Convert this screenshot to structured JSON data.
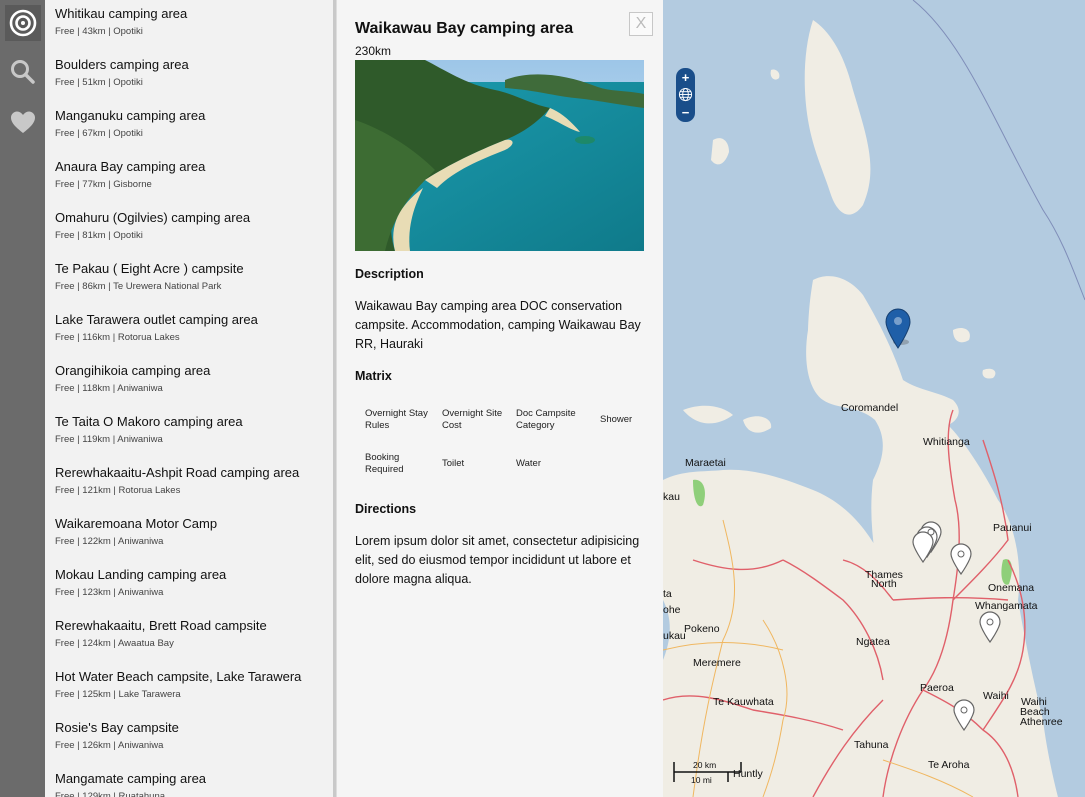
{
  "rail": {
    "icons": [
      "target-icon",
      "search-icon",
      "heart-icon"
    ]
  },
  "list": {
    "items": [
      {
        "name": "Whitikau camping area",
        "meta": "Free | 43km | Opotiki"
      },
      {
        "name": "Boulders camping area",
        "meta": "Free | 51km | Opotiki"
      },
      {
        "name": "Manganuku camping area",
        "meta": "Free | 67km | Opotiki"
      },
      {
        "name": "Anaura Bay camping area",
        "meta": "Free | 77km | Gisborne"
      },
      {
        "name": "Omahuru (Ogilvies) camping area",
        "meta": "Free | 81km | Opotiki"
      },
      {
        "name": "Te Pakau ( Eight Acre ) campsite",
        "meta": "Free | 86km | Te Urewera National Park"
      },
      {
        "name": "Lake Tarawera outlet camping area",
        "meta": "Free | 116km | Rotorua Lakes"
      },
      {
        "name": "Orangihikoia camping area",
        "meta": "Free | 118km | Aniwaniwa"
      },
      {
        "name": "Te Taita O Makoro camping area",
        "meta": "Free | 119km | Aniwaniwa"
      },
      {
        "name": "Rerewhakaaitu-Ashpit Road camping area",
        "meta": "Free | 121km | Rotorua Lakes"
      },
      {
        "name": "Waikaremoana Motor Camp",
        "meta": "Free | 122km | Aniwaniwa"
      },
      {
        "name": "Mokau Landing camping area",
        "meta": "Free | 123km | Aniwaniwa"
      },
      {
        "name": "Rerewhakaaitu, Brett Road campsite",
        "meta": "Free | 124km | Awaatua Bay"
      },
      {
        "name": "Hot Water Beach campsite, Lake Tarawera",
        "meta": "Free | 125km | Lake Tarawera"
      },
      {
        "name": "Rosie's Bay campsite",
        "meta": "Free | 126km | Aniwaniwa"
      },
      {
        "name": "Mangamate camping area",
        "meta": "Free | 129km | Ruatahuna"
      }
    ]
  },
  "detail": {
    "title": "Waikawau Bay camping area",
    "distance": "230km",
    "close_label": "X",
    "description_heading": "Description",
    "description": "Waikawau Bay camping area DOC conservation campsite. Accommodation, camping Waikawau Bay RR, Hauraki",
    "matrix_heading": "Matrix",
    "matrix": [
      [
        "Overnight Stay Rules",
        "Overnight Site Cost",
        "Doc Campsite Category",
        "Shower"
      ],
      [
        "Booking Required",
        "Toilet",
        "Water",
        ""
      ]
    ],
    "directions_heading": "Directions",
    "directions": "Lorem ipsum dolor sit amet, consectetur adipisicing elit, sed do eiusmod tempor incididunt ut labore et dolore magna aliqua."
  },
  "map": {
    "zoom_in": "+",
    "zoom_out": "−",
    "labels": {
      "coromandel": "Coromandel",
      "whitianga": "Whitianga",
      "maraetai": "Maraetai",
      "kau": "kau",
      "pauanui": "Pauanui",
      "thames": "Thames",
      "thames_north": "North",
      "onemana": "Onemana",
      "whangamata": "Whangamata",
      "ta": "ta",
      "ohe": "ohe",
      "ukau": "ukau",
      "pokeno": "Pokeno",
      "ngatea": "Ngatea",
      "meremere": "Meremere",
      "paeroa": "Paeroa",
      "waihi": "Waihi",
      "waihi_beach_1": "Waihi",
      "waihi_beach_2": "Beach",
      "waihi_beach_3": "Athenree",
      "te_kauwhata": "Te Kauwhata",
      "tahuna": "Tahuna",
      "te_aroha": "Te Aroha",
      "huntly": "Huntly"
    },
    "scale_km": "20 km",
    "scale_mi": "10 mi",
    "colors": {
      "sea": "#b3cbe0",
      "land": "#f0ede4",
      "road": "#e0606a",
      "pin_active": "#1f5fa8"
    }
  }
}
